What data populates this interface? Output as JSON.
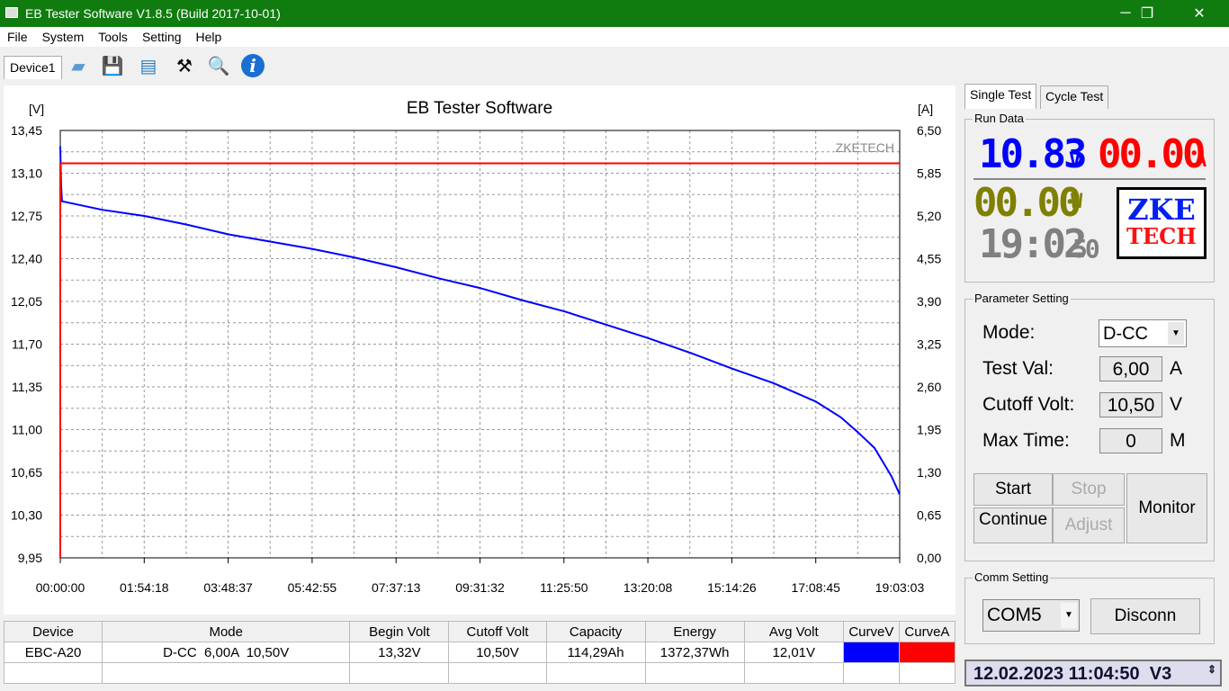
{
  "window": {
    "title": "EB Tester Software V1.8.5 (Build 2017-10-01)",
    "minimize": "─",
    "maximize": "❐",
    "close": "✕"
  },
  "menu": [
    "File",
    "System",
    "Tools",
    "Setting",
    "Help"
  ],
  "toolbar": {
    "device_tab": "Device1",
    "icons": [
      "open-folder-icon",
      "save-icon",
      "picture-icon",
      "tools-icon",
      "search-icon",
      "info-icon"
    ]
  },
  "tabs": {
    "single": "Single Test",
    "cycle": "Cycle Test"
  },
  "run_data": {
    "label": "Run Data",
    "voltage": "10.83",
    "voltage_unit": "V",
    "current": "00.00",
    "current_unit": "A",
    "power": "00.00",
    "power_unit": "W",
    "time": "19:02",
    "seconds": "50",
    "logo_top": "ZKE",
    "logo_bottom": "TECH"
  },
  "params": {
    "label": "Parameter Setting",
    "mode_label": "Mode:",
    "mode_value": "D-CC",
    "test_label": "Test Val:",
    "test_value": "6,00",
    "test_unit": "A",
    "cutoff_label": "Cutoff Volt:",
    "cutoff_value": "10,50",
    "cutoff_unit": "V",
    "maxtime_label": "Max Time:",
    "maxtime_value": "0",
    "maxtime_unit": "M"
  },
  "buttons": {
    "start": "Start",
    "stop": "Stop",
    "continue": "Continue",
    "adjust": "Adjust",
    "monitor": "Monitor"
  },
  "comm": {
    "label": "Comm Setting",
    "port": "COM5",
    "disconnect": "Disconn"
  },
  "clock": "12.02.2023 11:04:50  V3",
  "table": {
    "headers": [
      "Device",
      "Mode",
      "Begin Volt",
      "Cutoff Volt",
      "Capacity",
      "Energy",
      "Avg Volt",
      "CurveV",
      "CurveA"
    ],
    "rows": [
      [
        "EBC-A20",
        "D-CC  6,00A  10,50V",
        "13,32V",
        "10,50V",
        "114,29Ah",
        "1372,37Wh",
        "12,01V"
      ]
    ],
    "curve_colors": [
      "#0000ff",
      "#ff0000"
    ]
  },
  "chart_data": {
    "type": "line",
    "title": "EB Tester Software",
    "watermark": "ZKETECH",
    "ylabel": "[V]",
    "y2label": "[A]",
    "ylim": [
      9.95,
      13.45
    ],
    "y2lim": [
      0,
      6.5
    ],
    "xlim_seconds": [
      0,
      68583
    ],
    "yticks": [
      "9,95",
      "10,30",
      "10,65",
      "11,00",
      "11,35",
      "11,70",
      "12,05",
      "12,40",
      "12,75",
      "13,10",
      "13,45"
    ],
    "y2ticks": [
      "0,00",
      "0,65",
      "1,30",
      "1,95",
      "2,60",
      "3,25",
      "3,90",
      "4,55",
      "5,20",
      "5,85",
      "6,50"
    ],
    "xticks": [
      "00:00:00",
      "01:54:18",
      "03:48:37",
      "05:42:55",
      "07:37:13",
      "09:31:32",
      "11:25:50",
      "13:20:08",
      "15:14:26",
      "17:08:45",
      "19:03:03"
    ],
    "series": [
      {
        "name": "Voltage",
        "axis": "left",
        "color": "#0000ff",
        "x_frac": [
          0,
          0.001,
          0.002,
          0.05,
          0.1,
          0.15,
          0.2,
          0.25,
          0.3,
          0.35,
          0.4,
          0.45,
          0.5,
          0.55,
          0.6,
          0.65,
          0.7,
          0.75,
          0.8,
          0.85,
          0.9,
          0.93,
          0.95,
          0.97,
          0.99,
          1.0
        ],
        "values": [
          13.32,
          13.0,
          12.87,
          12.8,
          12.75,
          12.68,
          12.6,
          12.54,
          12.48,
          12.41,
          12.33,
          12.24,
          12.16,
          12.06,
          11.97,
          11.86,
          11.75,
          11.63,
          11.5,
          11.38,
          11.23,
          11.1,
          10.98,
          10.85,
          10.62,
          10.47
        ]
      },
      {
        "name": "Current",
        "axis": "right",
        "color": "#ff0000",
        "x_frac": [
          0,
          0,
          1
        ],
        "values": [
          0,
          6.0,
          6.0
        ]
      }
    ]
  }
}
